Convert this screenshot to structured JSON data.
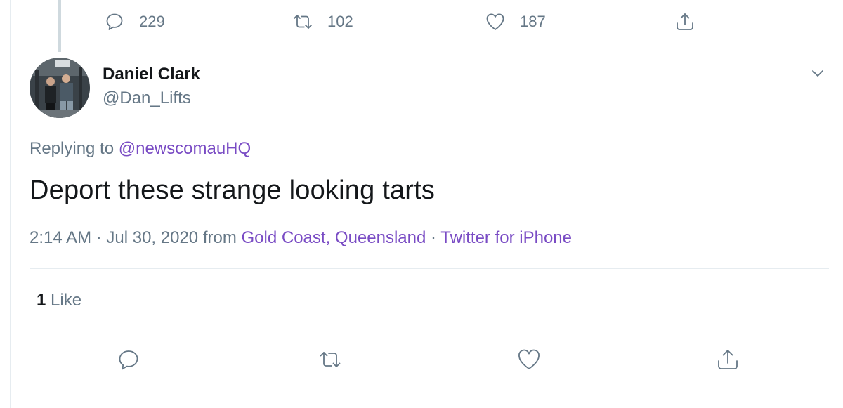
{
  "previous_tweet": {
    "reply_count": "229",
    "retweet_count": "102",
    "like_count": "187"
  },
  "tweet": {
    "author_name": "Daniel Clark",
    "author_handle": "@Dan_Lifts",
    "replying_prefix": "Replying to ",
    "replying_to": "@newscomauHQ",
    "text": "Deport these strange looking tarts",
    "time": "2:14 AM · Jul 30, 2020 from ",
    "location": "Gold Coast, Queensland",
    "separator": " · ",
    "source": "Twitter for iPhone",
    "likes_count": "1",
    "likes_label": "Like"
  },
  "icons": {
    "reply": "reply-icon",
    "retweet": "retweet-icon",
    "like": "heart-icon",
    "share": "share-icon",
    "more": "chevron-down-icon"
  },
  "colors": {
    "link": "#794bc4",
    "secondary_text": "#657786",
    "primary_text": "#14171a",
    "divider": "#e6ecf0"
  }
}
